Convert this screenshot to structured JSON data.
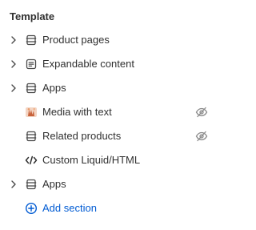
{
  "heading": "Template",
  "items": [
    {
      "label": "Product pages",
      "icon": "section-icon",
      "expandable": true,
      "hidden": false
    },
    {
      "label": "Expandable content",
      "icon": "text-block-icon",
      "expandable": true,
      "hidden": false
    },
    {
      "label": "Apps",
      "icon": "section-icon",
      "expandable": true,
      "hidden": false
    },
    {
      "label": "Media with text",
      "icon": "image-thumbnail-icon",
      "expandable": false,
      "hidden": true
    },
    {
      "label": "Related products",
      "icon": "section-icon",
      "expandable": false,
      "hidden": true
    },
    {
      "label": "Custom Liquid/HTML",
      "icon": "code-icon",
      "expandable": false,
      "hidden": false
    },
    {
      "label": "Apps",
      "icon": "section-icon",
      "expandable": true,
      "hidden": false
    }
  ],
  "add_section": {
    "label": "Add section",
    "icon": "plus-circle-icon"
  },
  "colors": {
    "text": "#303030",
    "icon": "#4a4a4a",
    "muted_icon": "#8a8a8a",
    "link": "#005bd3"
  }
}
